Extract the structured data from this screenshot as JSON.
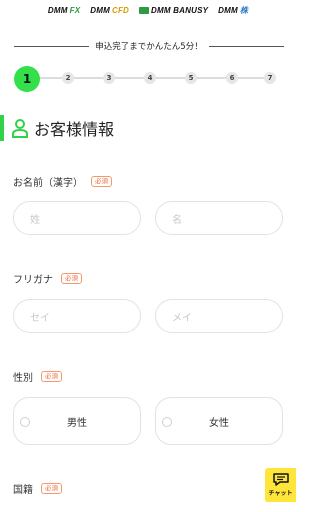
{
  "brands": [
    {
      "prefix": "DMM",
      "suffix": "FX",
      "style": "green"
    },
    {
      "prefix": "DMM",
      "suffix": "CFD",
      "style": "yellow"
    },
    {
      "prefix": "DMM BANUSY",
      "suffix": "",
      "style": "mark"
    },
    {
      "prefix": "DMM",
      "suffix": "株",
      "style": "blue"
    }
  ],
  "progress": {
    "heading": "申込完了までかんたん5分！",
    "current_step": 1,
    "steps": [
      "1",
      "2",
      "3",
      "4",
      "5",
      "6",
      "7"
    ]
  },
  "section": {
    "title": "お客様情報",
    "icon": "person-icon",
    "accent_color": "#33d04a"
  },
  "fields": {
    "required_badge": "必須",
    "name_kanji": {
      "label": "お名前（漢字）",
      "last_placeholder": "姓",
      "first_placeholder": "名"
    },
    "furigana": {
      "label": "フリガナ",
      "last_placeholder": "セイ",
      "first_placeholder": "メイ"
    },
    "gender": {
      "label": "性別",
      "options": [
        "男性",
        "女性"
      ]
    },
    "nationality": {
      "label": "国籍"
    }
  },
  "chat": {
    "label": "チャット",
    "icon": "chat-icon",
    "color": "#ffe43a"
  }
}
